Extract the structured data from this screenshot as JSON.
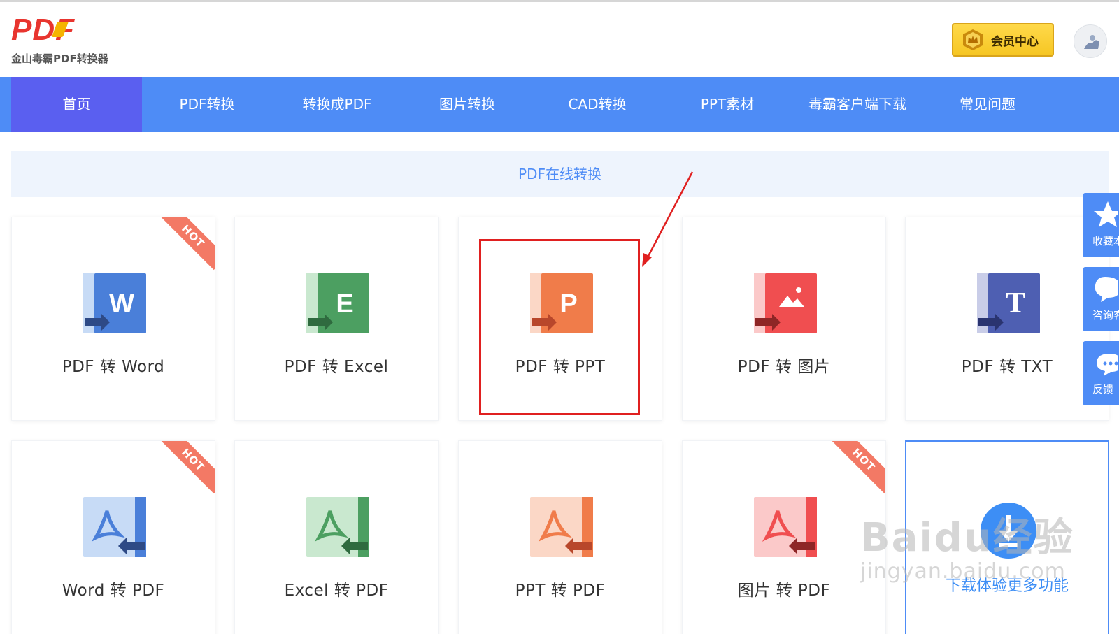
{
  "header": {
    "logo_text": "PDF",
    "logo_subtitle": "金山毒霸PDF转换器",
    "vip_button": "会员中心"
  },
  "nav": {
    "items": [
      "首页",
      "PDF转换",
      "转换成PDF",
      "图片转换",
      "CAD转换",
      "PPT素材",
      "毒霸客户端下载",
      "常见问题"
    ],
    "active_index": 0
  },
  "section": {
    "title": "PDF在线转换"
  },
  "cards": [
    {
      "label": "PDF 转 Word",
      "icon": "word-icon",
      "hot": "HOT",
      "color": "#4a7fd9"
    },
    {
      "label": "PDF 转 Excel",
      "icon": "excel-icon",
      "color": "#4c9f61"
    },
    {
      "label": "PDF 转 PPT",
      "icon": "ppt-icon",
      "color": "#f07c4a"
    },
    {
      "label": "PDF 转 图片",
      "icon": "image-icon",
      "color": "#f04e50"
    },
    {
      "label": "PDF 转 TXT",
      "icon": "txt-icon",
      "color": "#4e5fb2"
    },
    {
      "label": "Word 转 PDF",
      "icon": "pdf-blue-icon",
      "hot": "HOT",
      "color": "#4a7fd9"
    },
    {
      "label": "Excel 转 PDF",
      "icon": "pdf-green-icon",
      "color": "#4c9f61"
    },
    {
      "label": "PPT 转 PDF",
      "icon": "pdf-orange-icon",
      "color": "#f07c4a"
    },
    {
      "label": "图片 转 PDF",
      "icon": "pdf-red-icon",
      "hot": "HOT",
      "color": "#f04e50"
    }
  ],
  "download_card": {
    "label": "下载体验更多功能",
    "icon": "download-icon"
  },
  "side_tools": [
    {
      "label": "收藏本",
      "icon": "star-icon"
    },
    {
      "label": "咨询客",
      "icon": "chat-bubble-icon"
    },
    {
      "label": "反馈",
      "icon": "feedback-icon"
    }
  ],
  "watermark": {
    "brand": "Baidu经验",
    "url": "jingyan.baidu.com"
  },
  "colors": {
    "nav": "#4e8cf6",
    "nav_active": "#5a5ff0",
    "annotation": "#e02020"
  }
}
